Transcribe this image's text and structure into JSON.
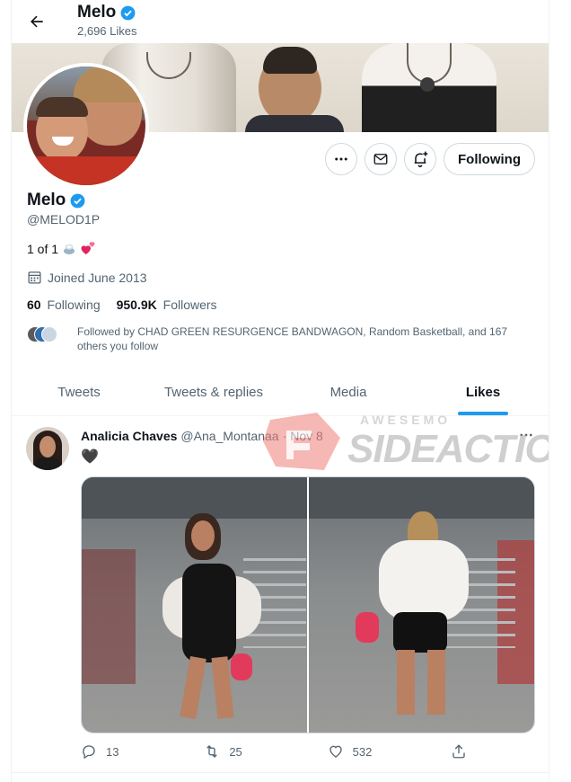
{
  "header": {
    "title": "Melo",
    "likes_count": "2,696 Likes"
  },
  "profile": {
    "name": "Melo",
    "handle": "@MELOD1P",
    "bio": "1 of 1",
    "joined": "Joined June 2013",
    "following_count": "60",
    "following_label": "Following",
    "followers_count": "950.9K",
    "followers_label": "Followers",
    "followed_by": "Followed by CHAD GREEN RESURGENCE BANDWAGON, Random Basketball, and 167 others you follow"
  },
  "actions": {
    "following_button": "Following"
  },
  "tabs": [
    {
      "label": "Tweets",
      "active": false
    },
    {
      "label": "Tweets & replies",
      "active": false
    },
    {
      "label": "Media",
      "active": false
    },
    {
      "label": "Likes",
      "active": true
    }
  ],
  "tweet": {
    "author_name": "Analicia Chaves",
    "author_handle": "@Ana_Montanaa",
    "separator": "·",
    "date": "Nov 8",
    "text": "🖤",
    "reply_count": "13",
    "retweet_count": "25",
    "like_count": "532"
  },
  "watermark": {
    "line1": "AWESEMO",
    "line2": "SIDEACTION"
  },
  "colors": {
    "accent": "#1d9bf0",
    "text_primary": "#0f1419",
    "text_secondary": "#536471",
    "border": "#cfd9de"
  },
  "icons": {
    "back": "arrow-left-icon",
    "verified": "verified-badge-icon",
    "more": "more-dots-icon",
    "message": "envelope-icon",
    "notify": "bell-plus-icon",
    "calendar": "calendar-icon",
    "reply": "reply-icon",
    "retweet": "retweet-icon",
    "like": "heart-icon",
    "share": "share-icon"
  }
}
